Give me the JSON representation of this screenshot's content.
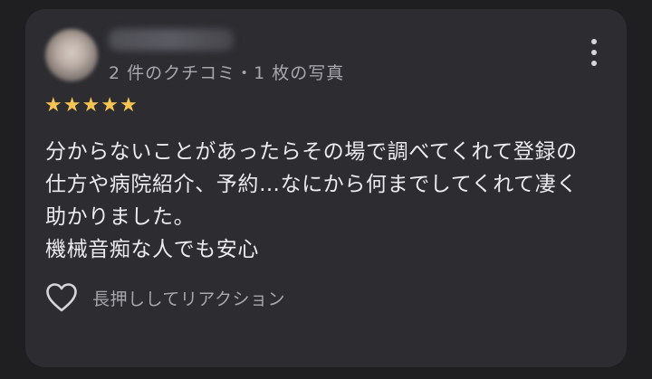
{
  "reviewer": {
    "meta": "2 件のクチコミ・1 枚の写真"
  },
  "rating": {
    "value": 5,
    "max": 5,
    "color": "#f6c453"
  },
  "review": {
    "lines": [
      "分からないことがあったらその場で調べてくれて登録の",
      "仕方や病院紹介、予約…なにから何までしてくれて凄く",
      "助かりました。",
      "機械音痴な人でも安心"
    ]
  },
  "reaction": {
    "label": "長押ししてリアクション",
    "icon": "heart-outline-icon"
  },
  "menu": {
    "icon": "more-vertical-icon"
  },
  "colors": {
    "background": "#1f1f21",
    "card": "#2c2c31",
    "text_primary": "#ececef",
    "text_secondary": "#a7a7ad"
  }
}
